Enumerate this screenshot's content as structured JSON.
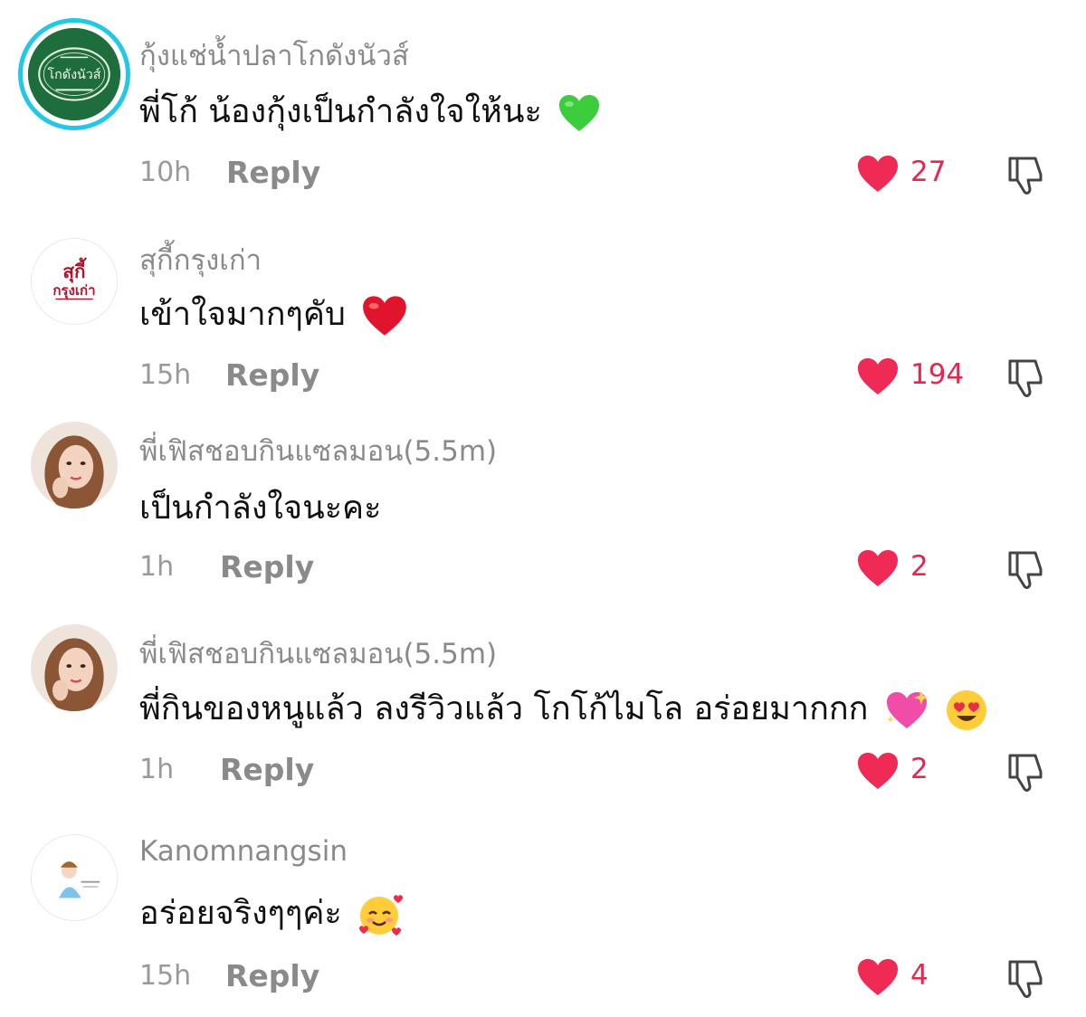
{
  "comments": [
    {
      "username": "กุ้งแช่น้ำปลาโกดังนัวส์",
      "text": "พี่โก้ น้องกุ้งเป็นกำลังใจให้นะ",
      "emoji": "green-heart",
      "time": "10h",
      "reply_label": "Reply",
      "likes": "27",
      "avatar": {
        "type": "logo-green",
        "ring_color": "#22c8e5",
        "logo_text": "โกดังนัวส์"
      }
    },
    {
      "username": "สุกี้กรุงเก่า",
      "text": "เข้าใจมากๆคับ",
      "emoji": "red-heart",
      "time": "15h",
      "reply_label": "Reply",
      "likes": "194",
      "avatar": {
        "type": "logo-red",
        "logo_text_1": "สุกี้",
        "logo_text_2": "กรุงเก่า"
      }
    },
    {
      "username": "พี่เฟิสชอบกินแซลมอน(5.5m)",
      "text": "เป็นกำลังใจนะคะ",
      "emoji": "",
      "time": "1h",
      "reply_label": "Reply",
      "likes": "2",
      "avatar": {
        "type": "photo-woman"
      }
    },
    {
      "username": "พี่เฟิสชอบกินแซลมอน(5.5m)",
      "text": "พี่กินของหนูแล้ว ลงรีวิวแล้ว โกโก้ไมโล อร่อยมากกก",
      "emoji": "sparkling-heart heart-eyes",
      "time": "1h",
      "reply_label": "Reply",
      "likes": "2",
      "avatar": {
        "type": "photo-woman"
      }
    },
    {
      "username": "Kanomnangsin",
      "text": "อร่อยจริงๆๆค่ะ",
      "emoji": "smiling-face-with-hearts",
      "time": "15h",
      "reply_label": "Reply",
      "likes": "4",
      "avatar": {
        "type": "logo-cartoon"
      }
    }
  ],
  "colors": {
    "like_heart": "#ee2a55",
    "like_count": "#e8254f",
    "muted_text": "#8a8a8a",
    "avatar_ring": "#22c8e5"
  },
  "icons": {
    "like": "heart-icon",
    "dislike": "thumbs-down-icon"
  }
}
